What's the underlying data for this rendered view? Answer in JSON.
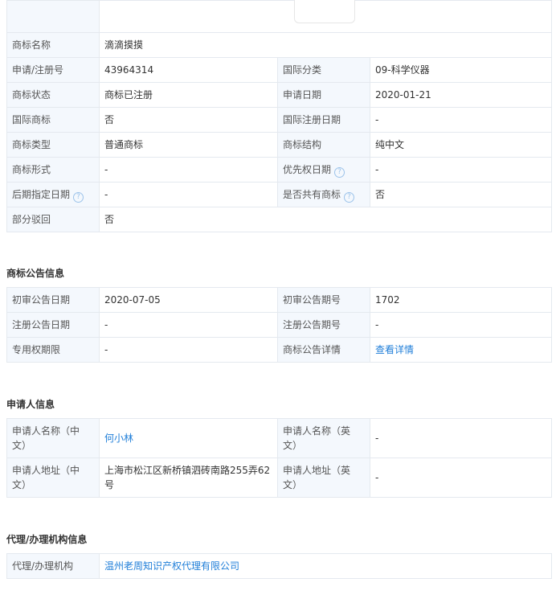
{
  "basic": {
    "name_label": "商标名称",
    "name_value": "滴滴摸摸",
    "reg_no_label": "申请/注册号",
    "reg_no_value": "43964314",
    "intl_class_label": "国际分类",
    "intl_class_value": "09-科学仪器",
    "status_label": "商标状态",
    "status_value": "商标已注册",
    "apply_date_label": "申请日期",
    "apply_date_value": "2020-01-21",
    "intl_mark_label": "国际商标",
    "intl_mark_value": "否",
    "intl_reg_date_label": "国际注册日期",
    "intl_reg_date_value": "-",
    "type_label": "商标类型",
    "type_value": "普通商标",
    "structure_label": "商标结构",
    "structure_value": "纯中文",
    "form_label": "商标形式",
    "form_value": "-",
    "priority_date_label": "优先权日期",
    "priority_date_value": "-",
    "later_date_label": "后期指定日期",
    "later_date_value": "-",
    "shared_label": "是否共有商标",
    "shared_value": "否",
    "partial_reject_label": "部分驳回",
    "partial_reject_value": "否",
    "help_glyph": "?"
  },
  "announcement": {
    "title": "商标公告信息",
    "prelim_date_label": "初审公告日期",
    "prelim_date_value": "2020-07-05",
    "prelim_no_label": "初审公告期号",
    "prelim_no_value": "1702",
    "reg_date_label": "注册公告日期",
    "reg_date_value": "-",
    "reg_no_label": "注册公告期号",
    "reg_no_value": "-",
    "exclusive_label": "专用权期限",
    "exclusive_value": "-",
    "detail_label": "商标公告详情",
    "detail_link": "查看详情"
  },
  "applicant": {
    "title": "申请人信息",
    "name_cn_label": "申请人名称（中文）",
    "name_cn_value": "何小林",
    "name_en_label": "申请人名称（英文）",
    "name_en_value": "-",
    "addr_cn_label": "申请人地址（中文）",
    "addr_cn_value": "上海市松江区新桥镇泗砖南路255弄62号",
    "addr_en_label": "申请人地址（英文）",
    "addr_en_value": "-"
  },
  "agency": {
    "title": "代理/办理机构信息",
    "agency_label": "代理/办理机构",
    "agency_value": "温州老周知识产权代理有限公司"
  },
  "colors": {
    "label_bg": "#f4f8fd",
    "border": "#e4e9ef",
    "link": "#1f7ed8"
  }
}
